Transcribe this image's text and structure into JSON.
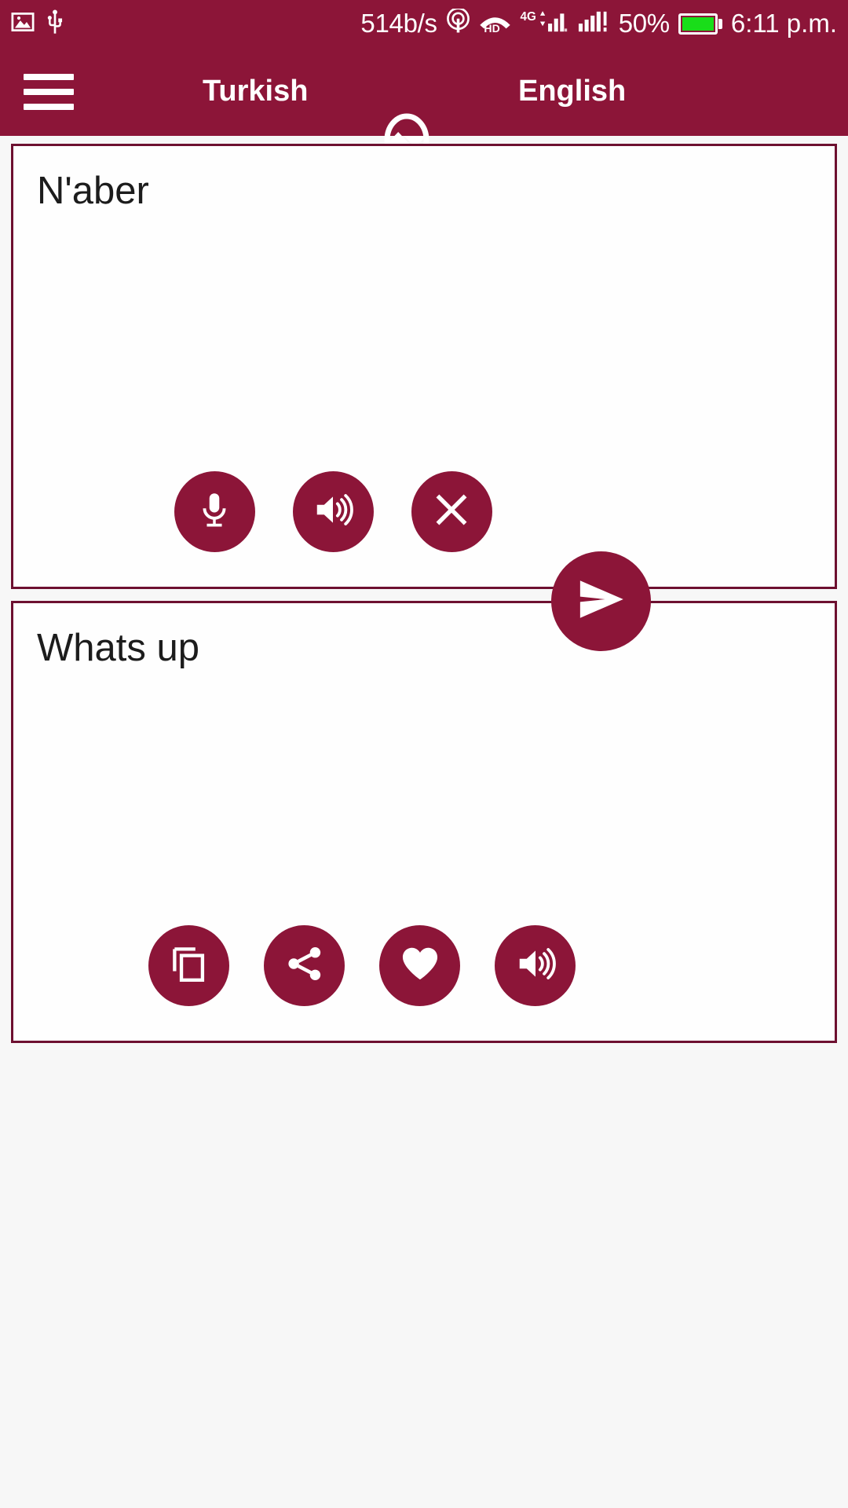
{
  "status_bar": {
    "network_speed": "514b/s",
    "battery_percent": "50%",
    "time": "6:11 p.m.",
    "icons": {
      "gallery": "image-icon",
      "usb": "usb-icon",
      "hotspot": "hotspot-icon",
      "hd_call": "hd-call-icon",
      "network_type": "4G",
      "signal_one": "signal-bars-icon",
      "signal_two": "signal-bars-icon",
      "battery": "battery-icon"
    }
  },
  "app_bar": {
    "menu_icon": "hamburger-menu-icon",
    "source_language": "Turkish",
    "swap_icon": "swap-languages-icon",
    "target_language": "English"
  },
  "source_card": {
    "text": "N'aber",
    "buttons": [
      {
        "name": "microphone",
        "icon": "microphone-icon"
      },
      {
        "name": "speak",
        "icon": "speaker-icon"
      },
      {
        "name": "clear",
        "icon": "close-icon"
      }
    ]
  },
  "target_card": {
    "text": "Whats up",
    "buttons": [
      {
        "name": "copy",
        "icon": "copy-icon"
      },
      {
        "name": "share",
        "icon": "share-icon"
      },
      {
        "name": "favorite",
        "icon": "heart-icon"
      },
      {
        "name": "speak",
        "icon": "speaker-icon"
      }
    ]
  },
  "send_button": {
    "icon": "send-icon"
  },
  "colors": {
    "brand": "#8c1538",
    "card_border": "#6d1030",
    "battery_fill": "#19dd19",
    "page_background": "#f7f7f7",
    "text": "#1c1c1c"
  }
}
